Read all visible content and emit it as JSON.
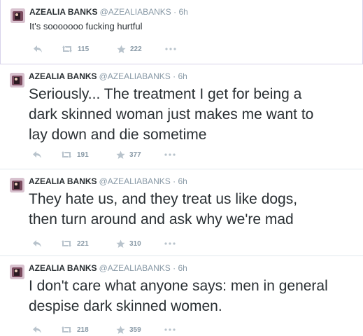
{
  "tweets": [
    {
      "name": "AZEALIA BANKS",
      "handle": "@AZEALIABANKS",
      "separator": "·",
      "time": "6h",
      "lines": [
        "It's sooooooo fucking hurtful"
      ],
      "retweets": "115",
      "favorites": "222"
    },
    {
      "name": "AZEALIA BANKS",
      "handle": "@AZEALIABANKS",
      "separator": "·",
      "time": "6h",
      "lines": [
        "Seriously... The treatment I get for being a",
        "dark skinned woman just makes me want to",
        "lay down and die sometime"
      ],
      "retweets": "191",
      "favorites": "377"
    },
    {
      "name": "AZEALIA BANKS",
      "handle": "@AZEALIABANKS",
      "separator": "·",
      "time": "6h",
      "lines": [
        "They hate us, and they treat us like dogs,",
        "then turn around and ask why we're mad"
      ],
      "retweets": "221",
      "favorites": "310"
    },
    {
      "name": "AZEALIA BANKS",
      "handle": "@AZEALIABANKS",
      "separator": "·",
      "time": "6h",
      "lines": [
        "I don't care what anyone says: men in general",
        "despise dark skinned women."
      ],
      "retweets": "218",
      "favorites": "359"
    }
  ],
  "icons": {
    "reply": "reply-icon",
    "retweet": "retweet-icon",
    "favorite": "star-icon",
    "more": "more-dots-icon"
  },
  "colors": {
    "text": "#292f33",
    "muted": "#8899a6",
    "icon": "#b8c3cc",
    "divider": "#e1e8ed"
  }
}
